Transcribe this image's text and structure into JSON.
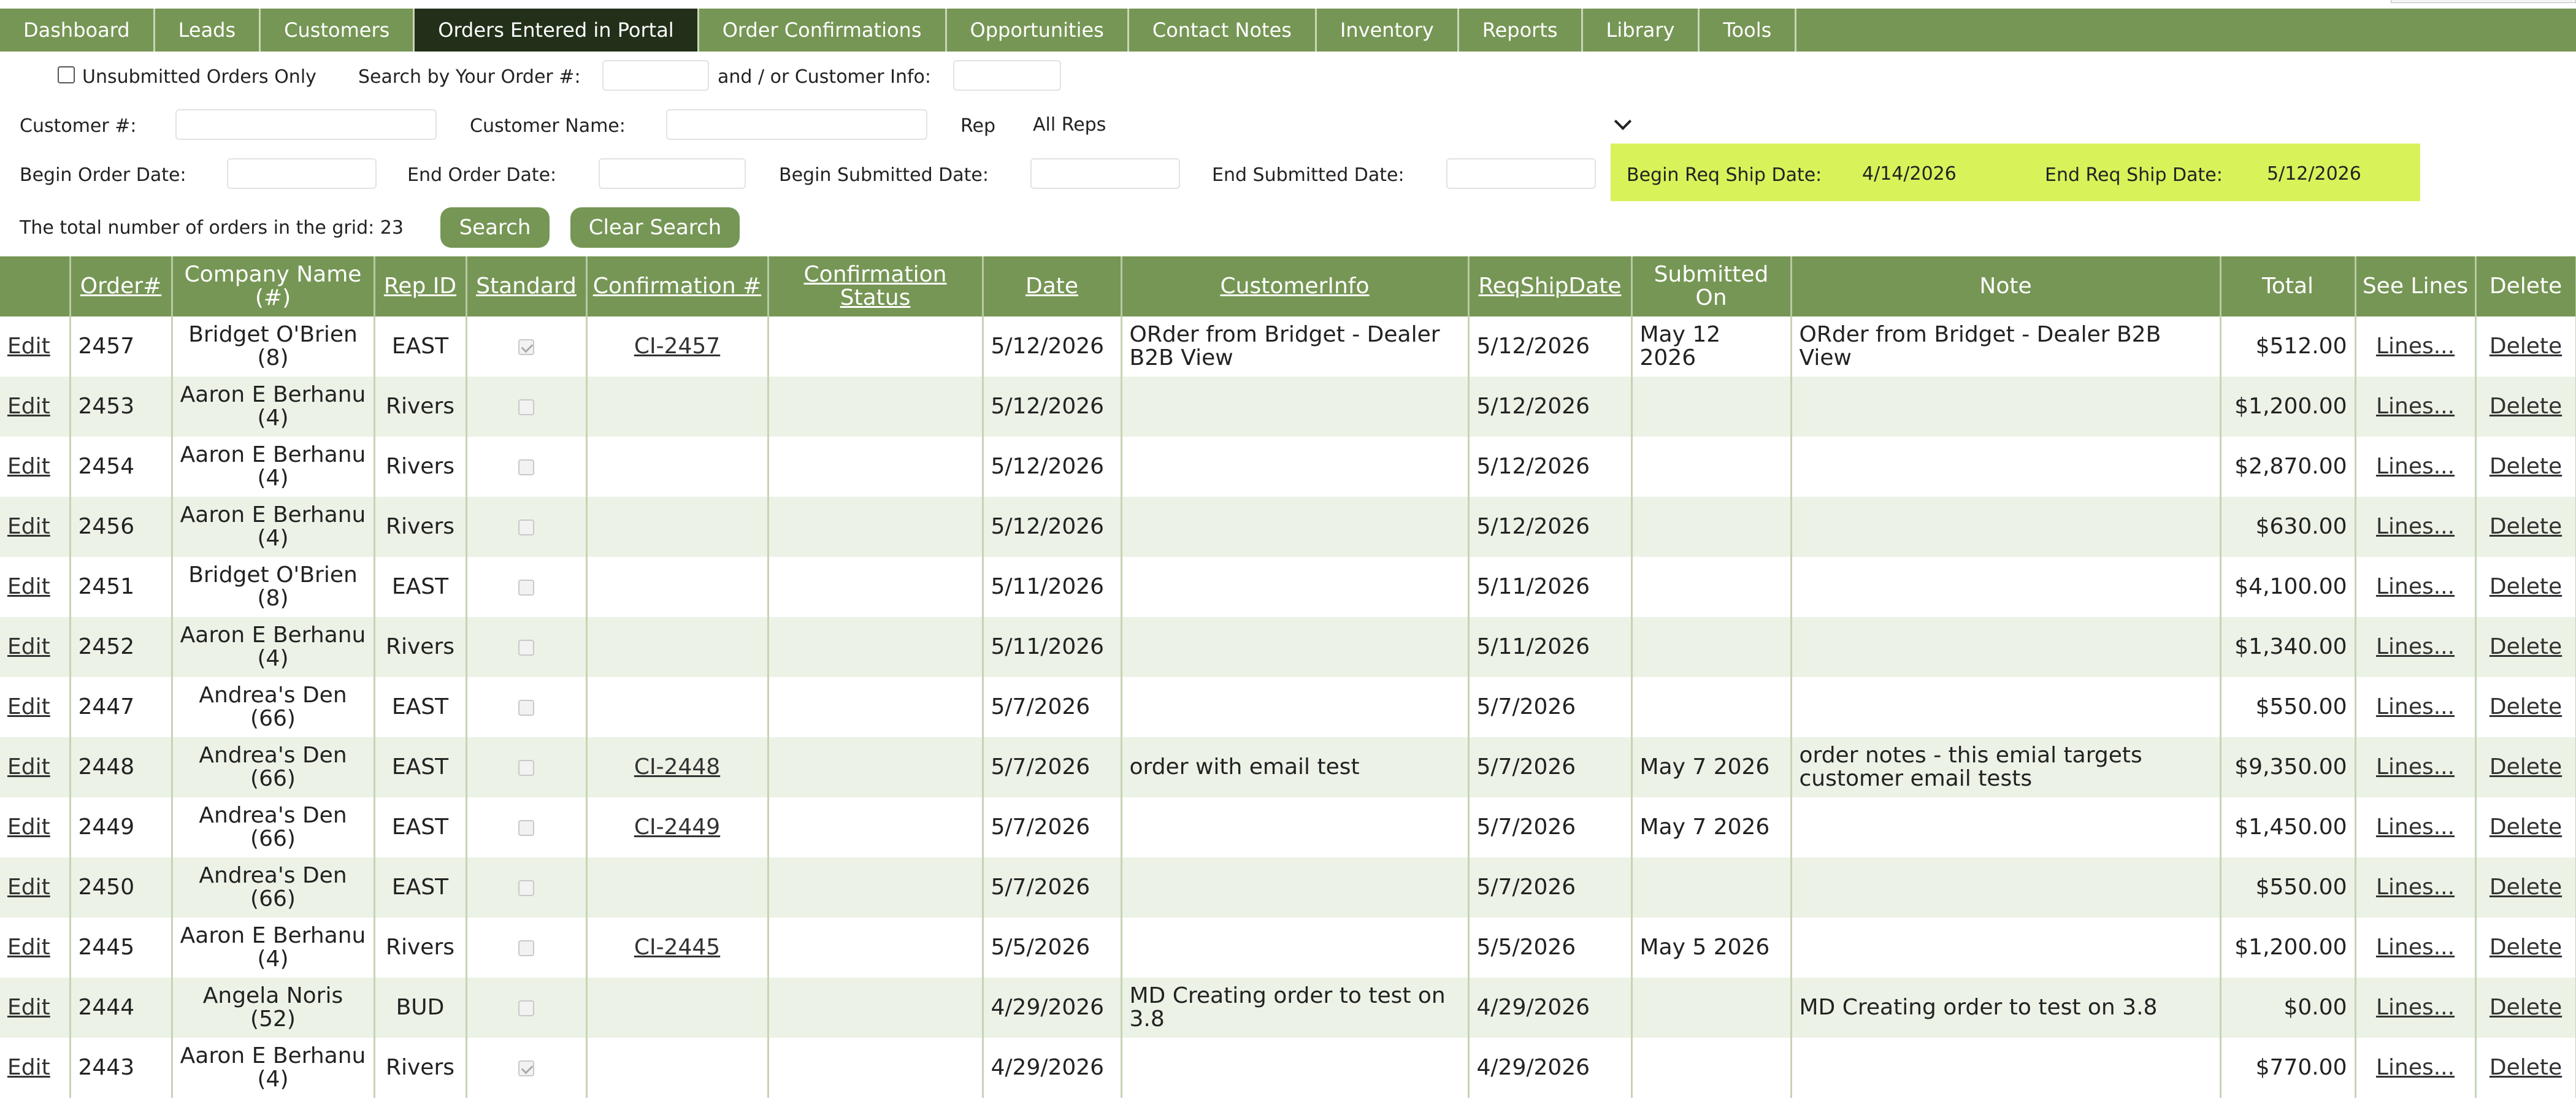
{
  "nav": {
    "items": [
      {
        "label": "Dashboard",
        "active": false
      },
      {
        "label": "Leads",
        "active": false
      },
      {
        "label": "Customers",
        "active": false
      },
      {
        "label": "Orders Entered in Portal",
        "active": true
      },
      {
        "label": "Order Confirmations",
        "active": false
      },
      {
        "label": "Opportunities",
        "active": false
      },
      {
        "label": "Contact Notes",
        "active": false
      },
      {
        "label": "Inventory",
        "active": false
      },
      {
        "label": "Reports",
        "active": false
      },
      {
        "label": "Library",
        "active": false
      },
      {
        "label": "Tools",
        "active": false
      }
    ]
  },
  "filters": {
    "unsubmitted_label": "Unsubmitted Orders Only",
    "search_order_label": "Search by Your Order #:",
    "order_value": "",
    "customer_info_label": "and / or Customer Info:",
    "customer_info_value": "",
    "customer_num_label": "Customer #:",
    "customer_num_value": "",
    "customer_name_label": "Customer Name:",
    "customer_name_value": "",
    "rep_label": "Rep",
    "rep_value": "All Reps",
    "begin_order_label": "Begin Order Date:",
    "begin_order_value": "",
    "end_order_label": "End Order Date:",
    "end_order_value": "",
    "begin_submitted_label": "Begin Submitted Date:",
    "begin_submitted_value": "",
    "end_submitted_label": "End Submitted Date:",
    "end_submitted_value": "",
    "begin_req_ship_label": "Begin Req Ship Date:",
    "begin_req_ship_value": "4/14/2026",
    "end_req_ship_label": "End Req Ship Date:",
    "end_req_ship_value": "5/12/2026",
    "total_label": "The total number of orders in the grid: 23",
    "search_button": "Search",
    "clear_button": "Clear Search",
    "highlight_color": "#d8f25a"
  },
  "grid": {
    "headers": [
      {
        "label": "",
        "link": false
      },
      {
        "label": "Order#",
        "link": true
      },
      {
        "label": "Company Name (#)",
        "link": false
      },
      {
        "label": "Rep ID",
        "link": true
      },
      {
        "label": "Standard",
        "link": true
      },
      {
        "label": "Confirmation #",
        "link": true
      },
      {
        "label": "Confirmation Status",
        "link": true
      },
      {
        "label": "Date",
        "link": true
      },
      {
        "label": "CustomerInfo",
        "link": true
      },
      {
        "label": "ReqShipDate",
        "link": true
      },
      {
        "label": "Submitted On",
        "link": false
      },
      {
        "label": "Note",
        "link": false
      },
      {
        "label": "Total",
        "link": false
      },
      {
        "label": "See Lines",
        "link": false
      },
      {
        "label": "Delete",
        "link": false
      }
    ],
    "rows": [
      {
        "edit": "Edit",
        "order": "2457",
        "company": "Bridget O'Brien (8)",
        "rep": "EAST",
        "standard": true,
        "conf": "CI-2457",
        "status": "",
        "date": "5/12/2026",
        "info": "ORder from Bridget - Dealer B2B View",
        "ship": "5/12/2026",
        "submitted": "May 12 2026",
        "note": "ORder from Bridget - Dealer B2B View",
        "total": "$512.00",
        "lines": "Lines...",
        "del": "Delete"
      },
      {
        "edit": "Edit",
        "order": "2453",
        "company": "Aaron E Berhanu (4)",
        "rep": "Rivers",
        "standard": false,
        "conf": "",
        "status": "",
        "date": "5/12/2026",
        "info": "",
        "ship": "5/12/2026",
        "submitted": "",
        "note": "",
        "total": "$1,200.00",
        "lines": "Lines...",
        "del": "Delete"
      },
      {
        "edit": "Edit",
        "order": "2454",
        "company": "Aaron E Berhanu (4)",
        "rep": "Rivers",
        "standard": false,
        "conf": "",
        "status": "",
        "date": "5/12/2026",
        "info": "",
        "ship": "5/12/2026",
        "submitted": "",
        "note": "",
        "total": "$2,870.00",
        "lines": "Lines...",
        "del": "Delete"
      },
      {
        "edit": "Edit",
        "order": "2456",
        "company": "Aaron E Berhanu (4)",
        "rep": "Rivers",
        "standard": false,
        "conf": "",
        "status": "",
        "date": "5/12/2026",
        "info": "",
        "ship": "5/12/2026",
        "submitted": "",
        "note": "",
        "total": "$630.00",
        "lines": "Lines...",
        "del": "Delete"
      },
      {
        "edit": "Edit",
        "order": "2451",
        "company": "Bridget O'Brien (8)",
        "rep": "EAST",
        "standard": false,
        "conf": "",
        "status": "",
        "date": "5/11/2026",
        "info": "",
        "ship": "5/11/2026",
        "submitted": "",
        "note": "",
        "total": "$4,100.00",
        "lines": "Lines...",
        "del": "Delete"
      },
      {
        "edit": "Edit",
        "order": "2452",
        "company": "Aaron E Berhanu (4)",
        "rep": "Rivers",
        "standard": false,
        "conf": "",
        "status": "",
        "date": "5/11/2026",
        "info": "",
        "ship": "5/11/2026",
        "submitted": "",
        "note": "",
        "total": "$1,340.00",
        "lines": "Lines...",
        "del": "Delete"
      },
      {
        "edit": "Edit",
        "order": "2447",
        "company": "Andrea's Den (66)",
        "rep": "EAST",
        "standard": false,
        "conf": "",
        "status": "",
        "date": "5/7/2026",
        "info": "",
        "ship": "5/7/2026",
        "submitted": "",
        "note": "",
        "total": "$550.00",
        "lines": "Lines...",
        "del": "Delete"
      },
      {
        "edit": "Edit",
        "order": "2448",
        "company": "Andrea's Den (66)",
        "rep": "EAST",
        "standard": false,
        "conf": "CI-2448",
        "status": "",
        "date": "5/7/2026",
        "info": "order with email test",
        "ship": "5/7/2026",
        "submitted": "May 7 2026",
        "note": "order notes - this emial targets customer email tests",
        "total": "$9,350.00",
        "lines": "Lines...",
        "del": "Delete"
      },
      {
        "edit": "Edit",
        "order": "2449",
        "company": "Andrea's Den (66)",
        "rep": "EAST",
        "standard": false,
        "conf": "CI-2449",
        "status": "",
        "date": "5/7/2026",
        "info": "",
        "ship": "5/7/2026",
        "submitted": "May 7 2026",
        "note": "",
        "total": "$1,450.00",
        "lines": "Lines...",
        "del": "Delete"
      },
      {
        "edit": "Edit",
        "order": "2450",
        "company": "Andrea's Den (66)",
        "rep": "EAST",
        "standard": false,
        "conf": "",
        "status": "",
        "date": "5/7/2026",
        "info": "",
        "ship": "5/7/2026",
        "submitted": "",
        "note": "",
        "total": "$550.00",
        "lines": "Lines...",
        "del": "Delete"
      },
      {
        "edit": "Edit",
        "order": "2445",
        "company": "Aaron E Berhanu (4)",
        "rep": "Rivers",
        "standard": false,
        "conf": "CI-2445",
        "status": "",
        "date": "5/5/2026",
        "info": "",
        "ship": "5/5/2026",
        "submitted": "May 5 2026",
        "note": "",
        "total": "$1,200.00",
        "lines": "Lines...",
        "del": "Delete"
      },
      {
        "edit": "Edit",
        "order": "2444",
        "company": "Angela Noris (52)",
        "rep": "BUD",
        "standard": false,
        "conf": "",
        "status": "",
        "date": "4/29/2026",
        "info": "MD Creating order to test on 3.8",
        "ship": "4/29/2026",
        "submitted": "",
        "note": "MD Creating order to test on 3.8",
        "total": "$0.00",
        "lines": "Lines...",
        "del": "Delete"
      },
      {
        "edit": "Edit",
        "order": "2443",
        "company": "Aaron E Berhanu (4)",
        "rep": "Rivers",
        "standard": true,
        "conf": "",
        "status": "",
        "date": "4/29/2026",
        "info": "",
        "ship": "4/29/2026",
        "submitted": "",
        "note": "",
        "total": "$770.00",
        "lines": "Lines...",
        "del": "Delete"
      }
    ]
  }
}
